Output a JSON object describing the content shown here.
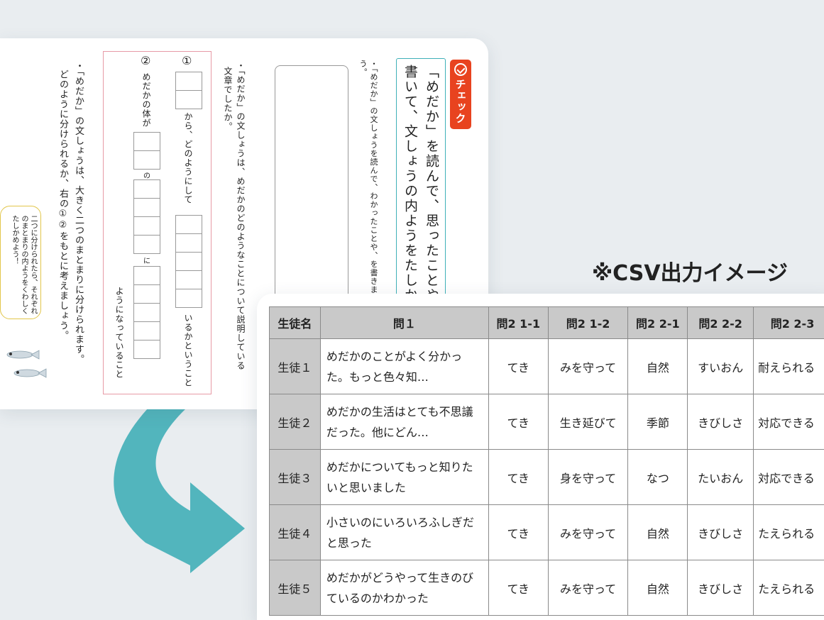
{
  "worksheet": {
    "check_label": "チェック",
    "title": "「めだか」を読んで、思ったことや書いて、文しょうの内ようをたしか",
    "instruction1": "・「めだか」の文しょうを読んで、わかったことや、を書きましょう。",
    "question1_line1": "・「めだか」の文しょうは、めだかのどのようなことについて説明している",
    "question1_line2": "文章でしたか。",
    "mark1": "①",
    "mark2": "②",
    "text_from": "から、どのようにして",
    "text_iruka": "いるかということ",
    "text_body": "めだかの体が",
    "text_no": "の",
    "text_ni": "に",
    "text_youni": "ようになっていること",
    "question2_line1": "・「めだか」の文しょうは、大きく二つのまとまりに分けられます。",
    "question2_line2": "どのように分けられるか、右の①②をもとに考えましょう。",
    "speech_bubble": "二つに分けられたら、それぞれのまとまりの内ようをくわしくたしかめよう！"
  },
  "csv_heading": "※CSV出力イメージ",
  "table": {
    "headers": [
      "生徒名",
      "問１",
      "問2 1-1",
      "問2 1-2",
      "問2 2-1",
      "問2 2-2",
      "問2 2-3"
    ],
    "rows": [
      [
        "生徒１",
        "めだかのことがよく分かった。もっと色々知…",
        "てき",
        "みを守って",
        "自然",
        "すいおん",
        "耐えられる"
      ],
      [
        "生徒２",
        "めだかの生活はとても不思議だった。他にどん…",
        "てき",
        "生き延びて",
        "季節",
        "きびしさ",
        "対応できる"
      ],
      [
        "生徒３",
        "めだかについてもっと知りたいと思いました",
        "てき",
        "身を守って",
        "なつ",
        "たいおん",
        "対応できる"
      ],
      [
        "生徒４",
        "小さいのにいろいろふしぎだと思った",
        "てき",
        "みを守って",
        "自然",
        "きびしさ",
        "たえられる"
      ],
      [
        "生徒５",
        "めだかがどうやって生きのびているのかわかった",
        "てき",
        "みを守って",
        "自然",
        "きびしさ",
        "たえられる"
      ]
    ]
  },
  "colors": {
    "background": "#e9edf0",
    "badge": "#e8431f",
    "title_border": "#3fb0b8",
    "arrow": "#52b5bd",
    "pink_border": "#e79aa6",
    "header_fill": "#c9c9c9"
  },
  "icons": [
    "check-circle-icon",
    "medaka-fish-icon",
    "curved-arrow-icon"
  ]
}
